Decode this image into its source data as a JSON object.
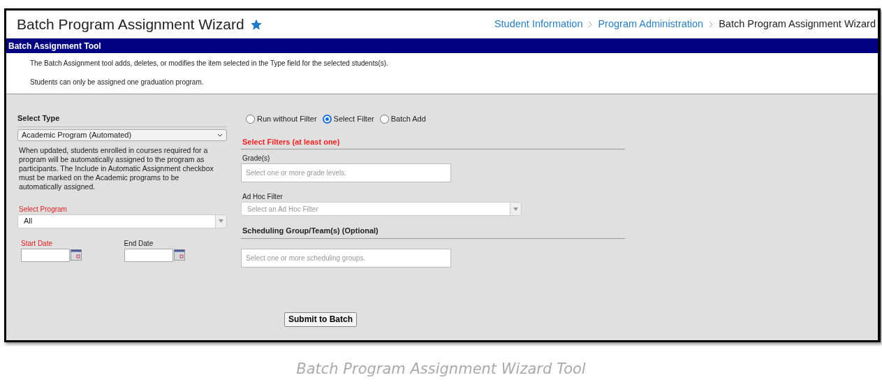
{
  "header": {
    "title": "Batch Program Assignment Wizard",
    "breadcrumbs": [
      {
        "label": "Student Information",
        "kind": "link"
      },
      {
        "label": "Program Administration",
        "kind": "link"
      },
      {
        "label": "Batch Program Assignment Wizard",
        "kind": "current"
      }
    ]
  },
  "tool_bar": {
    "title": "Batch Assignment Tool"
  },
  "intro": [
    "The Batch Assignment tool adds, deletes, or modifies the item selected in the Type field for the selected students(s).",
    "Students can only be assigned one graduation program."
  ],
  "select_type": {
    "label": "Select Type",
    "value": "Academic Program (Automated)"
  },
  "type_note": "When updated, students enrolled in courses required for a program will be automatically assigned to the program as participants. The Include in Automatic Assignment checkbox must be marked on the Academic programs to be automatically assigned.",
  "select_program": {
    "label": "Select Program",
    "value": "All"
  },
  "dates": [
    {
      "label": "Start Date",
      "required": true
    },
    {
      "label": "End Date",
      "required": false
    }
  ],
  "filter_modes": [
    {
      "label": "Run without Filter",
      "selected": false
    },
    {
      "label": "Select Filter",
      "selected": true
    },
    {
      "label": "Batch Add",
      "selected": false
    }
  ],
  "filters_heading": "Select Filters (at least one)",
  "grades": {
    "label": "Grade(s)",
    "placeholder": "Select one or more grade levels."
  },
  "ad_hoc": {
    "label": "Ad Hoc Filter",
    "placeholder": "Select an Ad Hoc Filter"
  },
  "scheduling_heading": "Scheduling Group/Team(s) (Optional)",
  "scheduling": {
    "placeholder": "Select one or more scheduling groups."
  },
  "submit_button": "Submit to Batch",
  "caption": "Batch Program Assignment Wizard Tool"
}
